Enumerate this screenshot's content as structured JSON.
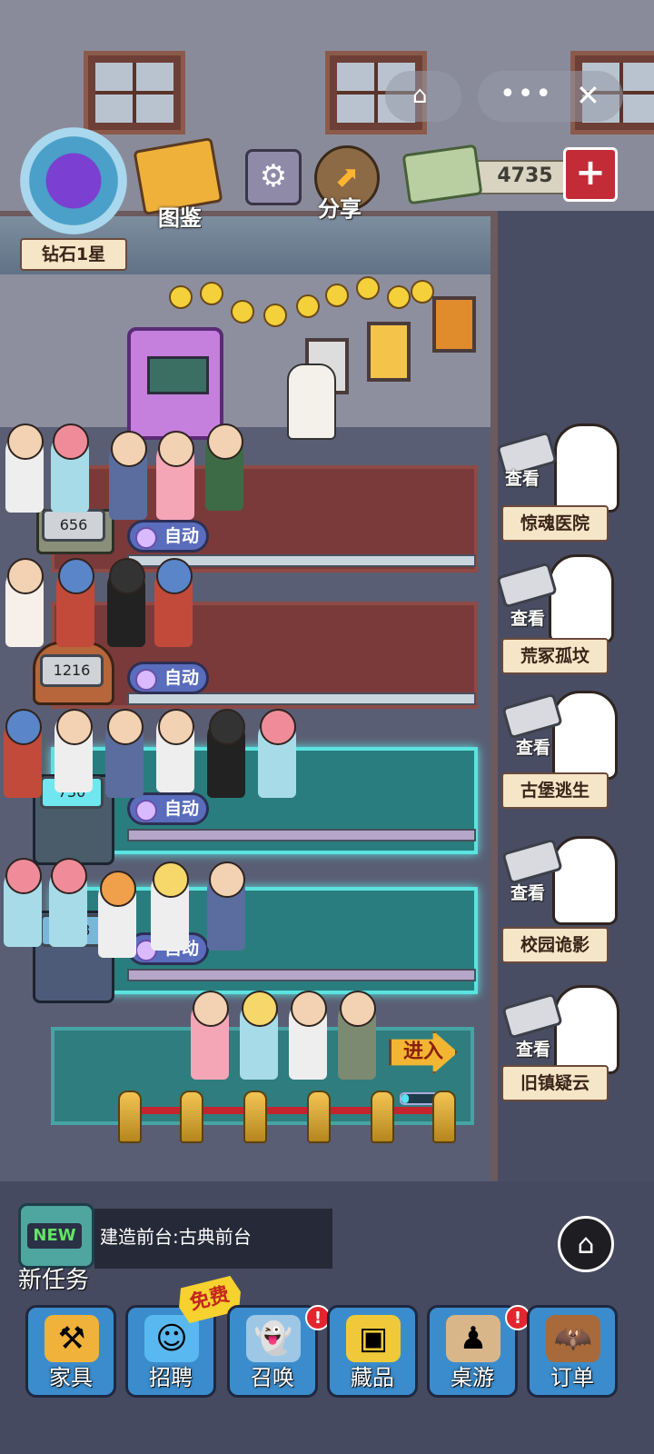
{
  "hud": {
    "rank_label": "钻石1星",
    "collection_label": "图鉴",
    "share_label": "分享",
    "cash": "4735",
    "settings_icon": "gear-icon",
    "add_icon": "plus-icon"
  },
  "miniprogram": {
    "home_icon": "home-icon",
    "more_icon": "more-icon",
    "close_icon": "close-icon"
  },
  "rooms": [
    {
      "counter": "656",
      "auto_label": "自动"
    },
    {
      "counter": "1216",
      "auto_label": "自动"
    },
    {
      "counter": "730",
      "auto_label": "自动"
    },
    {
      "counter": "1888",
      "auto_label": "自动"
    }
  ],
  "queue": {
    "enter_label": "进入",
    "progress": 0.15
  },
  "attractions": [
    {
      "view_label": "查看",
      "name": "惊魂医院"
    },
    {
      "view_label": "查看",
      "name": "荒冢孤坟"
    },
    {
      "view_label": "查看",
      "name": "古堡逃生"
    },
    {
      "view_label": "查看",
      "name": "校园诡影"
    },
    {
      "view_label": "查看",
      "name": "旧镇疑云"
    }
  ],
  "task": {
    "new_label": "NEW",
    "caption": "新任务",
    "text": "建造前台:古典前台"
  },
  "nav": [
    {
      "label": "家具",
      "icon": "hammer-wrench-icon",
      "color": "#f0b23a"
    },
    {
      "label": "招聘",
      "icon": "id-card-icon",
      "color": "#5ab8f0",
      "tag": "免费"
    },
    {
      "label": "召唤",
      "icon": "ghost-icon",
      "color": "#dfe8f0",
      "badge": "!"
    },
    {
      "label": "藏品",
      "icon": "safe-icon",
      "color": "#f0c93a"
    },
    {
      "label": "桌游",
      "icon": "chess-icon",
      "color": "#d9b68a",
      "badge": "!"
    },
    {
      "label": "订单",
      "icon": "bat-box-icon",
      "color": "#a86a3a"
    }
  ]
}
